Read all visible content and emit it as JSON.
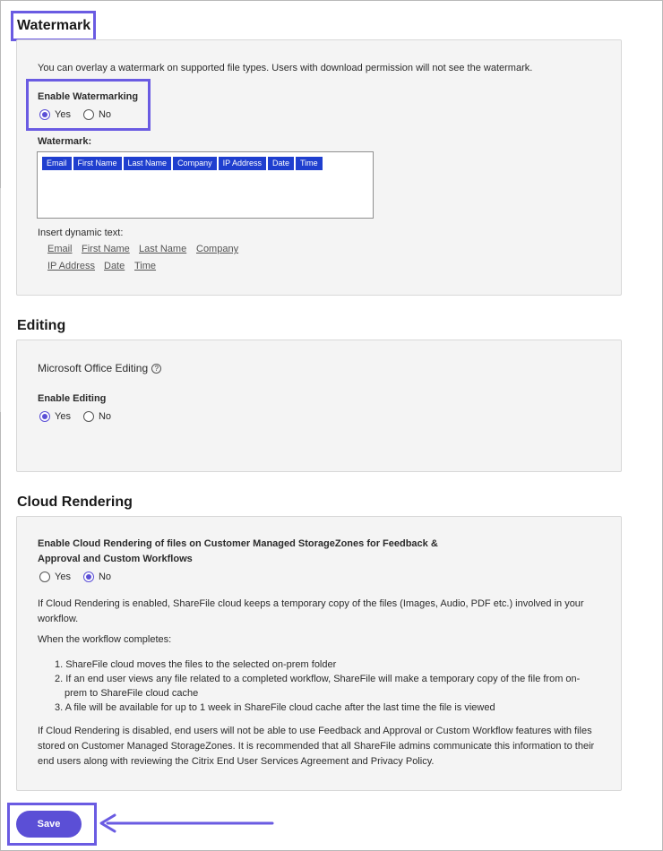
{
  "watermark": {
    "title": "Watermark",
    "description": "You can overlay a watermark on supported file types. Users with download permission will not see the watermark.",
    "enable_label": "Enable Watermarking",
    "yes_label": "Yes",
    "no_label": "No",
    "selected": "Yes",
    "field_label": "Watermark:",
    "tags": [
      "Email",
      "First Name",
      "Last Name",
      "Company",
      "IP Address",
      "Date",
      "Time"
    ],
    "insert_label": "Insert dynamic text:",
    "links_row1": [
      "Email",
      "First Name",
      "Last Name",
      "Company"
    ],
    "links_row2": [
      "IP Address",
      "Date",
      "Time"
    ]
  },
  "editing": {
    "title": "Editing",
    "subtitle": "Microsoft Office Editing",
    "help_glyph": "?",
    "enable_label": "Enable Editing",
    "yes_label": "Yes",
    "no_label": "No",
    "selected": "Yes"
  },
  "cloud": {
    "title": "Cloud Rendering",
    "enable_line1": "Enable Cloud Rendering of files on Customer Managed StorageZones for Feedback &",
    "enable_line2": "Approval and Custom Workflows",
    "yes_label": "Yes",
    "no_label": "No",
    "selected": "No",
    "info_line1": "If Cloud Rendering is enabled, ShareFile cloud keeps a temporary copy of the files (Images, Audio, PDF etc.) involved in your",
    "info_line2": "workflow.",
    "when_label": "When the workflow completes:",
    "step1": "1. ShareFile cloud moves the files to the selected on-prem folder",
    "step2_line1": "2. If an end user views any file related to a completed workflow, ShareFile will make a temporary copy of the file from on-",
    "step2_line2": "prem to ShareFile cloud cache",
    "step3": "3. A file will be available for up to 1 week in ShareFile cloud cache after the last time the file is viewed",
    "disabled_line1": "If Cloud Rendering is disabled, end users will not be able to use Feedback and Approval or Custom Workflow features with files",
    "disabled_line2": "stored on Customer Managed StorageZones. It is recommended that all ShareFile admins communicate this information to their",
    "disabled_line3": "end users along with reviewing the Citrix End User Services Agreement and Privacy Policy."
  },
  "save_label": "Save",
  "colors": {
    "accent": "#5b4fd6",
    "highlight": "#6a5be2",
    "tag": "#1f3fcf",
    "panel": "#f4f4f4"
  }
}
